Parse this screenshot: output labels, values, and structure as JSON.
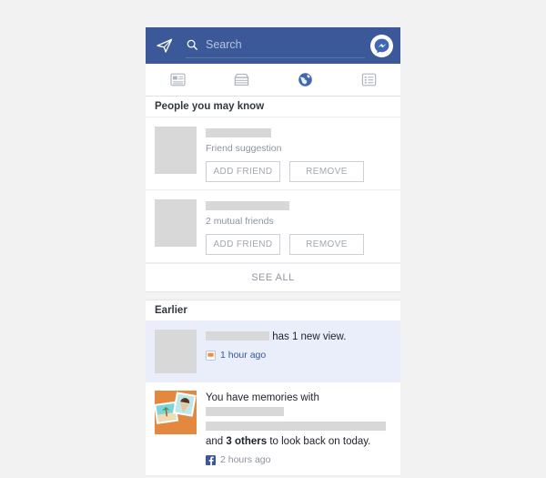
{
  "header": {
    "send_icon": "paper-plane-icon",
    "search_placeholder": "Search",
    "search_value": "",
    "search_icon": "search-icon",
    "messenger_icon": "messenger-icon",
    "background_color": "#3b5998"
  },
  "tabs": [
    {
      "name": "news-feed",
      "icon": "news-feed-icon",
      "active": false
    },
    {
      "name": "marketplace",
      "icon": "marketplace-icon",
      "active": false
    },
    {
      "name": "notifications",
      "icon": "globe-icon",
      "active": true
    },
    {
      "name": "menu",
      "icon": "list-menu-icon",
      "active": false
    }
  ],
  "active_tab_color": "#4267b2",
  "people_you_may_know": {
    "title": "People you may know",
    "suggestions": [
      {
        "subtitle": "Friend suggestion",
        "add_label": "ADD FRIEND",
        "remove_label": "REMOVE"
      },
      {
        "subtitle": "2 mutual friends",
        "add_label": "ADD FRIEND",
        "remove_label": "REMOVE"
      }
    ],
    "see_all_label": "SEE ALL"
  },
  "earlier": {
    "title": "Earlier",
    "notifications": [
      {
        "text_after_name": "has 1 new view.",
        "timestamp": "1 hour ago",
        "meta_icon": "story-badge-icon",
        "unread": true
      },
      {
        "text_start": "You have memories with",
        "text_middle": "and",
        "text_strong": "3 others",
        "text_end": "to look back on today.",
        "timestamp": "2 hours ago",
        "meta_icon": "facebook-f-icon",
        "unread": false
      }
    ]
  },
  "colors": {
    "facebook_blue": "#3b5998",
    "link_blue": "#365899",
    "unread_background": "#e9eefa",
    "page_background": "#f2f2f2",
    "placeholder_gray": "#d8d8d8"
  }
}
